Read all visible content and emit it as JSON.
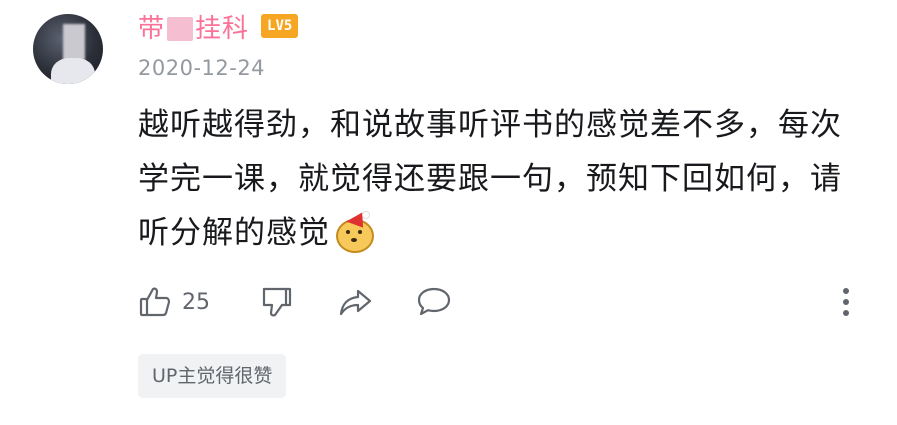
{
  "comment": {
    "username_part1": "带",
    "username_part2": "挂科",
    "level_badge": "LV5",
    "date": "2020-12-24",
    "content": "越听越得劲，和说故事听评书的感觉差不多，每次学完一课，就觉得还要跟一句，预知下回如何，请听分解的感觉",
    "emoji": "doge-santa-emoji",
    "like_count": "25",
    "up_tag": "UP主觉得很赞"
  },
  "colors": {
    "username": "#fb7299",
    "level_badge": "#f6a623",
    "secondary_text": "#9499a0",
    "icon": "#61666d",
    "tag_background": "#f1f2f3"
  },
  "icons": {
    "like": "thumbs-up-icon",
    "dislike": "thumbs-down-icon",
    "share": "share-arrow-icon",
    "reply": "speech-bubble-icon",
    "more": "vertical-dots-icon"
  }
}
